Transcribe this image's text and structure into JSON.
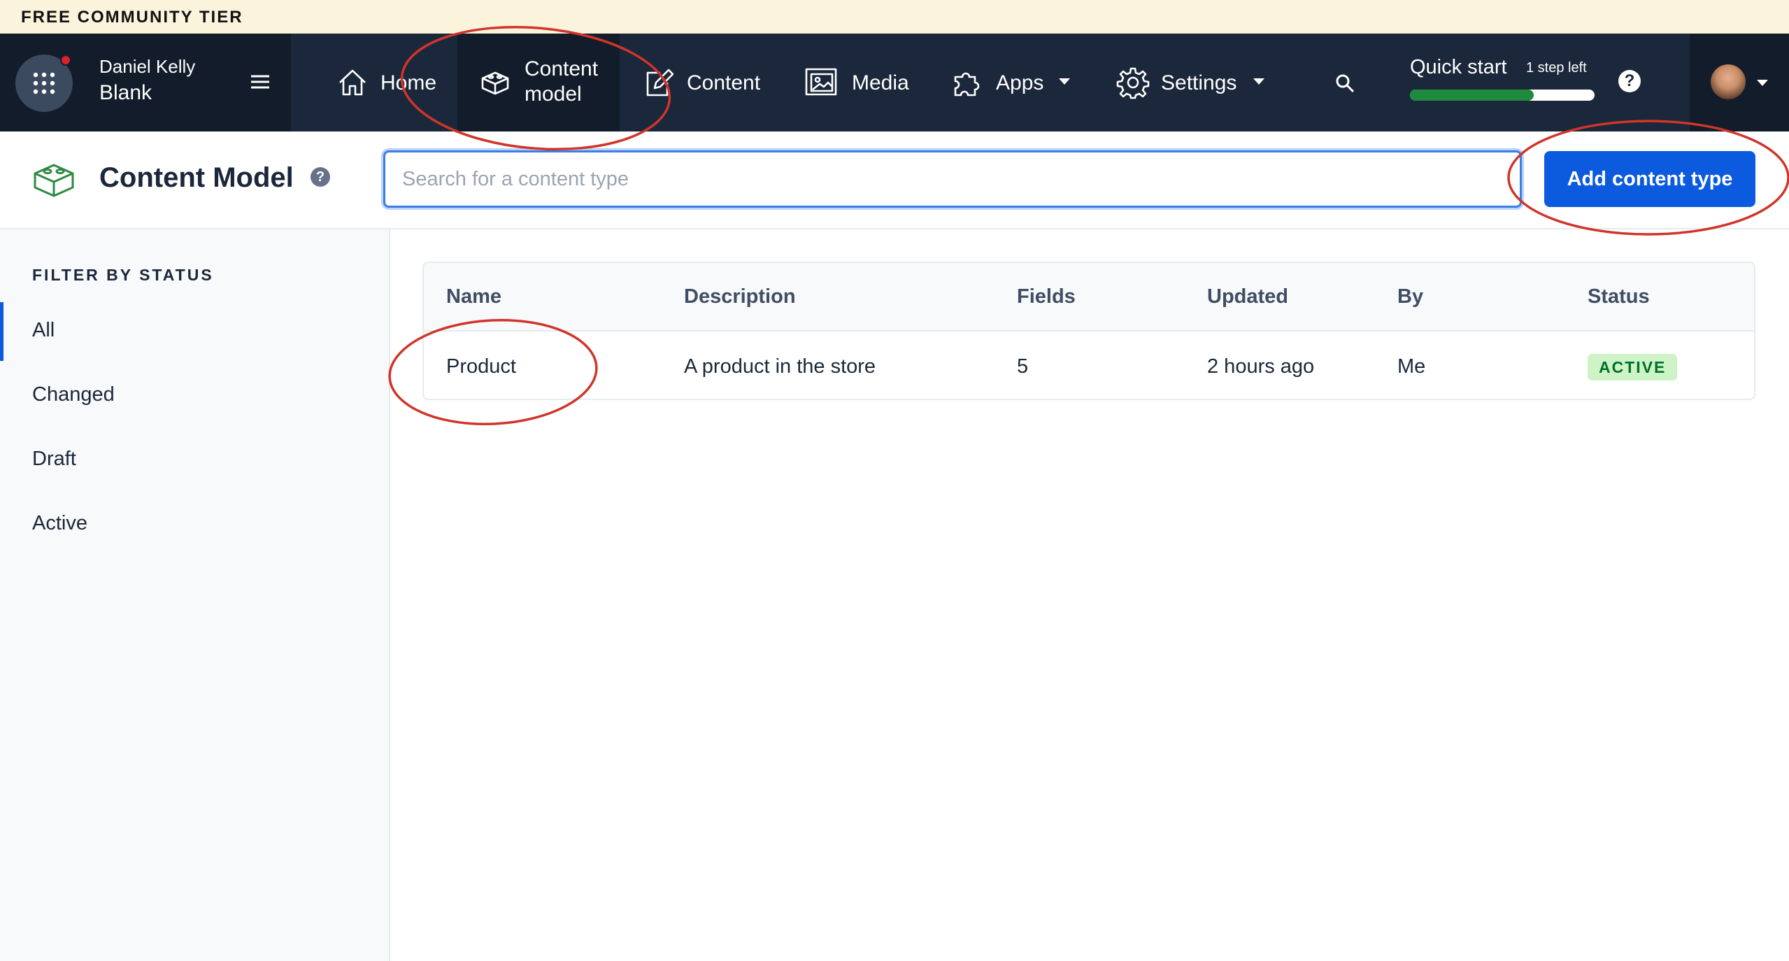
{
  "banner": {
    "text": "FREE COMMUNITY TIER"
  },
  "space": {
    "org_name": "Daniel Kelly",
    "environment": "Blank",
    "icon": "grid-icon",
    "notification_color": "#d9222a"
  },
  "nav": {
    "items": [
      {
        "label": "Home",
        "icon": "home-icon"
      },
      {
        "label_line1": "Content",
        "label_line2": "model",
        "icon": "content-model-icon",
        "active": true
      },
      {
        "label": "Content",
        "icon": "content-icon"
      },
      {
        "label": "Media",
        "icon": "media-icon"
      },
      {
        "label": "Apps",
        "icon": "apps-icon",
        "dropdown": true
      },
      {
        "label": "Settings",
        "icon": "gear-icon",
        "dropdown": true
      }
    ],
    "quick_start": {
      "label": "Quick start",
      "steps_left": "1 step left",
      "progress": 0.67,
      "progress_color": "#1e8a3c"
    },
    "help": "?"
  },
  "header": {
    "title": "Content Model",
    "help": "?",
    "search_placeholder": "Search for a content type",
    "add_button": "Add content type",
    "accent_color": "#0c5ade"
  },
  "sidebar": {
    "heading": "FILTER BY STATUS",
    "items": [
      {
        "label": "All",
        "active": true
      },
      {
        "label": "Changed"
      },
      {
        "label": "Draft"
      },
      {
        "label": "Active"
      }
    ]
  },
  "table": {
    "columns": [
      "Name",
      "Description",
      "Fields",
      "Updated",
      "By",
      "Status"
    ],
    "rows": [
      {
        "name": "Product",
        "description": "A product in the store",
        "fields": "5",
        "updated": "2 hours ago",
        "by": "Me",
        "status": "ACTIVE"
      }
    ],
    "status_colors": {
      "active_bg": "#cdf3c6",
      "active_text": "#006f2c"
    }
  },
  "annotations": {
    "color": "#d0352a",
    "targets": [
      "Content model nav item",
      "Add content type button",
      "Product row"
    ]
  }
}
